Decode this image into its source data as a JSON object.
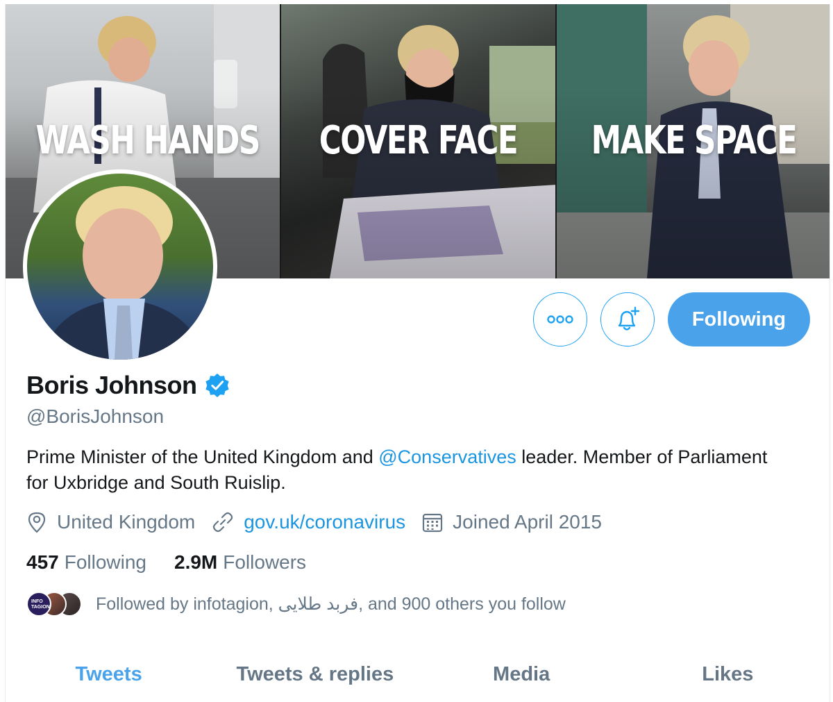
{
  "banner": {
    "slogans": [
      "WASH HANDS",
      "COVER FACE",
      "MAKE SPACE"
    ]
  },
  "actions": {
    "more_icon": "more-dots-icon",
    "notify_icon": "bell-plus-icon",
    "following_label": "Following"
  },
  "profile": {
    "name": "Boris Johnson",
    "verified_icon": "verified-badge-icon",
    "handle": "@BorisJohnson",
    "bio_prefix": "Prime Minister of the United Kingdom and ",
    "bio_mention": "@Conservatives",
    "bio_suffix": " leader. Member of Parliament for Uxbridge and South Ruislip.",
    "location": "United Kingdom",
    "website": "gov.uk/coronavirus",
    "joined": "Joined April 2015"
  },
  "counts": {
    "following_num": "457",
    "following_label": "Following",
    "followers_num": "2.9M",
    "followers_label": "Followers"
  },
  "followed_by": {
    "text": "Followed by infotagion, فربد طلایی, and 900 others you follow",
    "mini_avatar_text": "INFO TAGION"
  },
  "tabs": [
    {
      "label": "Tweets",
      "active": true
    },
    {
      "label": "Tweets & replies",
      "active": false
    },
    {
      "label": "Media",
      "active": false
    },
    {
      "label": "Likes",
      "active": false
    }
  ],
  "colors": {
    "accent": "#1da1f2",
    "button_fill": "#4aa3ea",
    "link": "#1b95e0",
    "secondary_text": "#657786"
  }
}
